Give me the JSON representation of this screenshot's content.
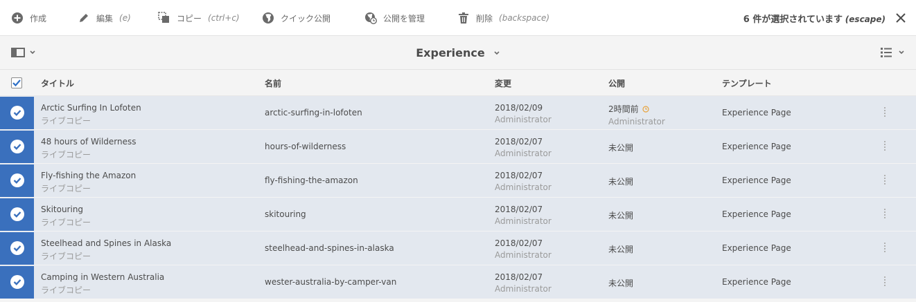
{
  "actions": [
    {
      "label": "作成",
      "hint": ""
    },
    {
      "label": "編集",
      "hint": "(e)"
    },
    {
      "label": "コピー",
      "hint": "(ctrl+c)"
    },
    {
      "label": "クイック公開",
      "hint": ""
    },
    {
      "label": "公開を管理",
      "hint": ""
    },
    {
      "label": "削除",
      "hint": "(backspace)"
    }
  ],
  "selection": {
    "text": "6 件が選択されています",
    "hint": "(escape)"
  },
  "header": {
    "title": "Experience"
  },
  "columns": {
    "title": "タイトル",
    "name": "名前",
    "modified": "変更",
    "published": "公開",
    "template": "テンプレート"
  },
  "rows": [
    {
      "title": "Arctic Surfing In Lofoten",
      "sub": "ライブコピー",
      "name": "arctic-surfing-in-lofoten",
      "date": "2018/02/09",
      "user": "Administrator",
      "published": "2時間前",
      "published_by": "Administrator",
      "template": "Experience Page"
    },
    {
      "title": "48 hours of Wilderness",
      "sub": "ライブコピー",
      "name": "hours-of-wilderness",
      "date": "2018/02/07",
      "user": "Administrator",
      "published": "未公開",
      "published_by": "",
      "template": "Experience Page"
    },
    {
      "title": "Fly-fishing the Amazon",
      "sub": "ライブコピー",
      "name": "fly-fishing-the-amazon",
      "date": "2018/02/07",
      "user": "Administrator",
      "published": "未公開",
      "published_by": "",
      "template": "Experience Page"
    },
    {
      "title": "Skitouring",
      "sub": "ライブコピー",
      "name": "skitouring",
      "date": "2018/02/07",
      "user": "Administrator",
      "published": "未公開",
      "published_by": "",
      "template": "Experience Page"
    },
    {
      "title": "Steelhead and Spines in Alaska",
      "sub": "ライブコピー",
      "name": "steelhead-and-spines-in-alaska",
      "date": "2018/02/07",
      "user": "Administrator",
      "published": "未公開",
      "published_by": "",
      "template": "Experience Page"
    },
    {
      "title": "Camping in Western Australia",
      "sub": "ライブコピー",
      "name": "wester-australia-by-camper-van",
      "date": "2018/02/07",
      "user": "Administrator",
      "published": "未公開",
      "published_by": "",
      "template": "Experience Page"
    }
  ],
  "colors": {
    "selected_row": "#e3e8ef",
    "thumb": "#3a70bd",
    "accent": "#2d6fc6",
    "clock": "#e8a33d"
  }
}
